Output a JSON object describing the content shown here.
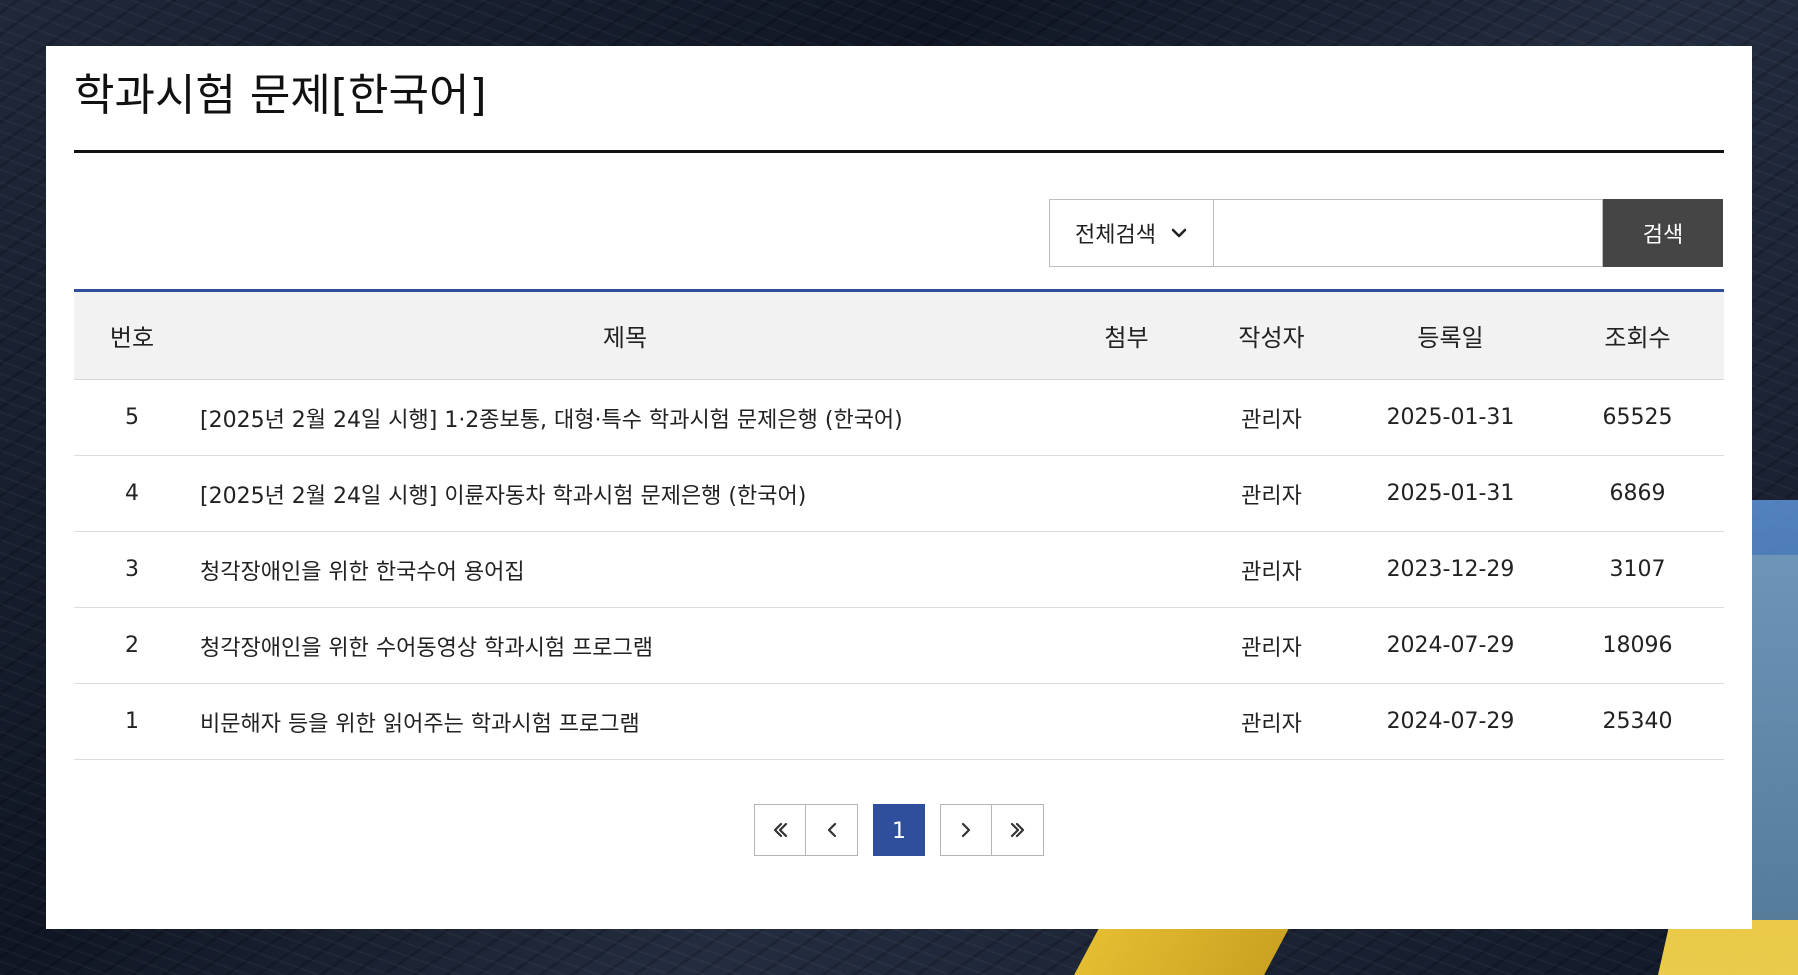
{
  "page": {
    "title": "학과시험 문제[한국어]"
  },
  "search": {
    "select_label": "전체검색",
    "placeholder": "",
    "button_label": "검색"
  },
  "table": {
    "headers": {
      "no": "번호",
      "title": "제목",
      "attachment": "첨부",
      "author": "작성자",
      "date": "등록일",
      "views": "조회수"
    },
    "rows": [
      {
        "no": "5",
        "title": "[2025년 2월 24일 시행] 1·2종보통, 대형·특수 학과시험 문제은행 (한국어)",
        "attachment": "",
        "author": "관리자",
        "date": "2025-01-31",
        "views": "65525"
      },
      {
        "no": "4",
        "title": "[2025년 2월 24일 시행] 이륜자동차 학과시험 문제은행 (한국어)",
        "attachment": "",
        "author": "관리자",
        "date": "2025-01-31",
        "views": "6869"
      },
      {
        "no": "3",
        "title": "청각장애인을 위한 한국수어 용어집",
        "attachment": "",
        "author": "관리자",
        "date": "2023-12-29",
        "views": "3107"
      },
      {
        "no": "2",
        "title": "청각장애인을 위한 수어동영상 학과시험 프로그램",
        "attachment": "",
        "author": "관리자",
        "date": "2024-07-29",
        "views": "18096"
      },
      {
        "no": "1",
        "title": "비문해자 등을 위한 읽어주는 학과시험 프로그램",
        "attachment": "",
        "author": "관리자",
        "date": "2024-07-29",
        "views": "25340"
      }
    ]
  },
  "pagination": {
    "current_page": "1"
  },
  "icons": {
    "dropdown": "chevron-down-icon",
    "first": "double-chevron-left-icon",
    "prev": "chevron-left-icon",
    "next": "chevron-right-icon",
    "last": "double-chevron-right-icon"
  },
  "colors": {
    "accent_blue": "#2f4f9c",
    "button_dark": "#454545",
    "text_dark": "#222222"
  }
}
